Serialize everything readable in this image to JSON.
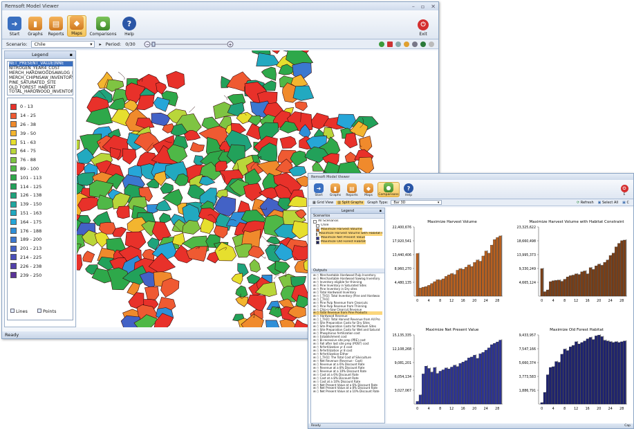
{
  "main": {
    "title": "Remsoft Model Viewer",
    "ribbon": [
      "Start",
      "Graphs",
      "Reports",
      "Maps",
      "Comparisons",
      "Help"
    ],
    "active": "Maps",
    "exit": "Exit",
    "scenario_label": "Scenario:",
    "scenario_value": "Chile",
    "period_label": "Period:",
    "period_value": "0/30",
    "legend_title": "Legend",
    "attributes": [
      "NET_PRESENT_VALUE(NNE",
      "NITROGEN_YEAR4_COST",
      "MERCH_HARDWOODSAWLOG_II",
      "MERCH_CHIPNSAW_INVENTORY",
      "PINE_SATURATED_SITE",
      "OLD_FOREST_HABITAT",
      "TOTAL_HARDWOOD_INVENTOR"
    ],
    "classes": [
      {
        "label": "0 - 13",
        "color": "#e8312a"
      },
      {
        "label": "14 - 25",
        "color": "#ef5a32"
      },
      {
        "label": "26 - 38",
        "color": "#f08a2c"
      },
      {
        "label": "39 - 50",
        "color": "#f3b52f"
      },
      {
        "label": "51 - 63",
        "color": "#e6df2e"
      },
      {
        "label": "64 - 75",
        "color": "#b9d63a"
      },
      {
        "label": "76 - 88",
        "color": "#7fc442"
      },
      {
        "label": "89 - 100",
        "color": "#4fb847"
      },
      {
        "label": "101 - 113",
        "color": "#2ea84a"
      },
      {
        "label": "114 - 125",
        "color": "#22a15a"
      },
      {
        "label": "126 - 138",
        "color": "#1fa37c"
      },
      {
        "label": "139 - 150",
        "color": "#20a7a0"
      },
      {
        "label": "151 - 163",
        "color": "#22a9c0"
      },
      {
        "label": "164 - 175",
        "color": "#26a6d8"
      },
      {
        "label": "176 - 188",
        "color": "#2f8fd8"
      },
      {
        "label": "189 - 200",
        "color": "#3b78d0"
      },
      {
        "label": "201 - 213",
        "color": "#4362c6"
      },
      {
        "label": "214 - 225",
        "color": "#4a4fba"
      },
      {
        "label": "226 - 238",
        "color": "#5240aa"
      },
      {
        "label": "239 - 250",
        "color": "#5a3398"
      }
    ],
    "lines_label": "Lines",
    "points_label": "Points",
    "status": "Ready"
  },
  "second": {
    "title": "Remsoft Model Viewer",
    "ribbon": [
      "Start",
      "Graphs",
      "Reports",
      "Maps",
      "Comparisons",
      "Help"
    ],
    "active": "Comparisons",
    "exit": "E",
    "grid_view": "Grid View",
    "split_graphs": "Split Graphs",
    "graph_type_label": "Graph Type:",
    "graph_type_value": "Bar 3D",
    "refresh": "Refresh",
    "select_all": "Select All",
    "c": "C",
    "legend_title": "Legend",
    "scenarios_title": "Scenarios",
    "scenarios": [
      {
        "label": "All Scenarios",
        "color": ""
      },
      {
        "label": "Chile",
        "color": "#f0f0f0"
      },
      {
        "label": "Maximize Harvest Volume",
        "color": "#c8702a"
      },
      {
        "label": "Maximize Harvest Volume with Habitat Constr",
        "color": "#8a4a22"
      },
      {
        "label": "Maximize Net Present Value",
        "color": "#2a2f8a"
      },
      {
        "label": "Maximize Old Forest Habitat",
        "color": "#1c1f5a"
      }
    ],
    "outputs_title": "Outputs",
    "outputs": [
      "Merchantable Hardwood Pulp Inventory",
      "Merchantable Hardwood Sawlog Inventory",
      "Inventory eligible for thinning",
      "Pine Inventory in Saturated Sites",
      "Pine Inventory in Dry sites",
      "Total Hardwood Inventory",
      "[_TH1]: Total Inventory (Pine and Hardwoo",
      "[_TH1]",
      "Pine Pulp Revenue from Clearcuts",
      "Pine Pulp Revenue from Thinning",
      "Chip-n-Saw Clearcut Revenue",
      "Total Revenue from Pine Products",
      "Hardwood Revenue",
      "[_TH2]: Total Harvest Revenue from All Pro",
      "Site Preparation Costs for Dry Sites",
      "Site Preparation Costs for Medium Sites",
      "Site Preparation Costs for Wet and Saturat",
      "Phosphorus fertilization cost",
      "Establishment cost",
      "Bi-recessive site prep (PRE) cost",
      "Fall after last site prep (POST) cost",
      "N-fertilization yr 4 cost",
      "N-fertilization yr 8 cost",
      "N-fertilization-Either",
      "[_TH1]: The Total Cost of Silviculture",
      "Net Revenue (Revenue - Cost)",
      "Revenue at a 6% Discount Rate",
      "Revenue at a 8% Discount Rate",
      "Revenue at a 10% Discount Rate",
      "Cost at a 6% Discount Rate",
      "Cost at a 8% Discount Rate",
      "Cost at a 10% Discount Rate",
      "Net Present Value at a 6% Discount Rate",
      "Net Present Value at a 8% Discount Rate",
      "Net Present Value at a 10% Discount Rate"
    ],
    "outputs_highlight": 11,
    "status": "Ready",
    "status_right": "Cap"
  },
  "chart_data": [
    {
      "type": "bar",
      "title": "Maximize Harvest Volume",
      "color": "#b8601f",
      "yticks": [
        "22,400,676",
        "17,920,541",
        "13,440,406",
        "8,960,270",
        "4,480,135"
      ],
      "ylim": [
        0,
        22400676
      ],
      "xticks": [
        "0",
        "4",
        "8",
        "12",
        "16",
        "20",
        "24",
        "28"
      ],
      "values": [
        13800000,
        2600000,
        2900000,
        3100000,
        3500000,
        4100000,
        4700000,
        5300000,
        5200000,
        5600000,
        6400000,
        6900000,
        7300000,
        7000000,
        8400000,
        8900000,
        8700000,
        9400000,
        10100000,
        9600000,
        10900000,
        11700000,
        11300000,
        13000000,
        14600000,
        13900000,
        16500000,
        18300000,
        19000000,
        19500000
      ]
    },
    {
      "type": "bar",
      "title": "Maximize Harvest Volume with Habitat Constraint",
      "color": "#7a3f17",
      "yticks": [
        "23,325,622",
        "18,660,498",
        "13,995,373",
        "9,330,249",
        "4,665,124"
      ],
      "ylim": [
        0,
        23325622
      ],
      "xticks": [
        "0",
        "4",
        "8",
        "12",
        "16",
        "20",
        "24",
        "28"
      ],
      "values": [
        9300000,
        1500000,
        2100000,
        4900000,
        5200000,
        5300000,
        5400000,
        5000000,
        5700000,
        6500000,
        6900000,
        7100000,
        7500000,
        7300000,
        8200000,
        8500000,
        7500000,
        9600000,
        9000000,
        10200000,
        10800000,
        10400000,
        11400000,
        12200000,
        13700000,
        14500000,
        16600000,
        17800000,
        18700000,
        18900000
      ]
    },
    {
      "type": "bar",
      "title": "Maximize Net Present Value",
      "color": "#2c3393",
      "yticks": [
        "15,135,335",
        "12,108,268",
        "9,081,201",
        "6,054,134",
        "3,027,067"
      ],
      "ylim": [
        0,
        15135335
      ],
      "xticks": [
        "0",
        "4",
        "8",
        "12",
        "16",
        "20",
        "24",
        "28"
      ],
      "values": [
        600000,
        2000000,
        6600000,
        8300000,
        7800000,
        7000000,
        8000000,
        6700000,
        7200000,
        7500000,
        7900000,
        7700000,
        8100000,
        8500000,
        8200000,
        8900000,
        9200000,
        9500000,
        10100000,
        10300000,
        10700000,
        10000000,
        11000000,
        11300000,
        11800000,
        12300000,
        13000000,
        13300000,
        13600000,
        14000000
      ]
    },
    {
      "type": "bar",
      "title": "Maximize Old Forest Habitat",
      "color": "#1e2370",
      "yticks": [
        "9,433,957",
        "7,547,166",
        "5,660,374",
        "3,773,583",
        "1,886,791"
      ],
      "ylim": [
        0,
        9433957
      ],
      "xticks": [
        "0",
        "4",
        "8",
        "12",
        "16",
        "20",
        "24",
        "28"
      ],
      "values": [
        200000,
        1600000,
        4000000,
        5000000,
        5100000,
        5800000,
        5700000,
        6800000,
        7500000,
        7300000,
        7800000,
        8000000,
        8500000,
        8200000,
        8400000,
        8600000,
        8900000,
        9100000,
        8800000,
        9300000,
        9400000,
        9200000,
        8700000,
        8600000,
        8500000,
        8400000,
        8500000,
        8400000,
        8500000,
        8600000
      ]
    }
  ]
}
